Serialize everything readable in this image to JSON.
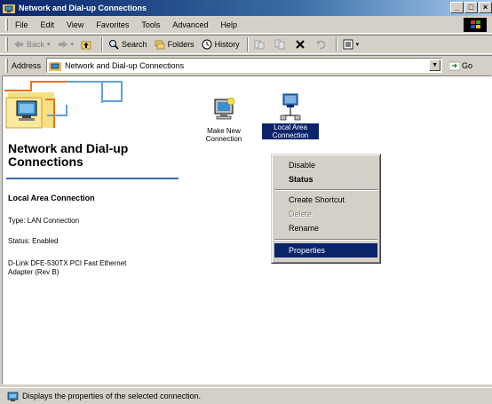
{
  "window": {
    "title": "Network and Dial-up Connections",
    "buttons": {
      "minimize": "_",
      "maximize": "□",
      "close": "×"
    }
  },
  "menubar": {
    "items": [
      "File",
      "Edit",
      "View",
      "Favorites",
      "Tools",
      "Advanced",
      "Help"
    ]
  },
  "toolbar": {
    "back": "Back",
    "search": "Search",
    "folders": "Folders",
    "history": "History"
  },
  "address": {
    "label": "Address",
    "value": "Network and Dial-up Connections",
    "go": "Go"
  },
  "left_pane": {
    "title": "Network and Dial-up Connections",
    "selected_name": "Local Area Connection",
    "type": "Type: LAN Connection",
    "status": "Status: Enabled",
    "device": "D-Link DFE-530TX PCI Fast Ethernet Adapter (Rev B)"
  },
  "icons": [
    {
      "label": "Make New Connection",
      "selected": false
    },
    {
      "label": "Local Area Connection",
      "selected": true
    }
  ],
  "context_menu": {
    "items": [
      {
        "label": "Disable",
        "state": "normal"
      },
      {
        "label": "Status",
        "state": "bold"
      },
      {
        "label": "Create Shortcut",
        "state": "normal"
      },
      {
        "label": "Delete",
        "state": "disabled"
      },
      {
        "label": "Rename",
        "state": "normal"
      },
      {
        "label": "Properties",
        "state": "highlighted"
      }
    ]
  },
  "statusbar": {
    "text": "Displays the properties of the selected connection."
  },
  "colors": {
    "title_bar": "#0a246a",
    "highlight": "#0a246a",
    "face": "#d4d0c8"
  }
}
